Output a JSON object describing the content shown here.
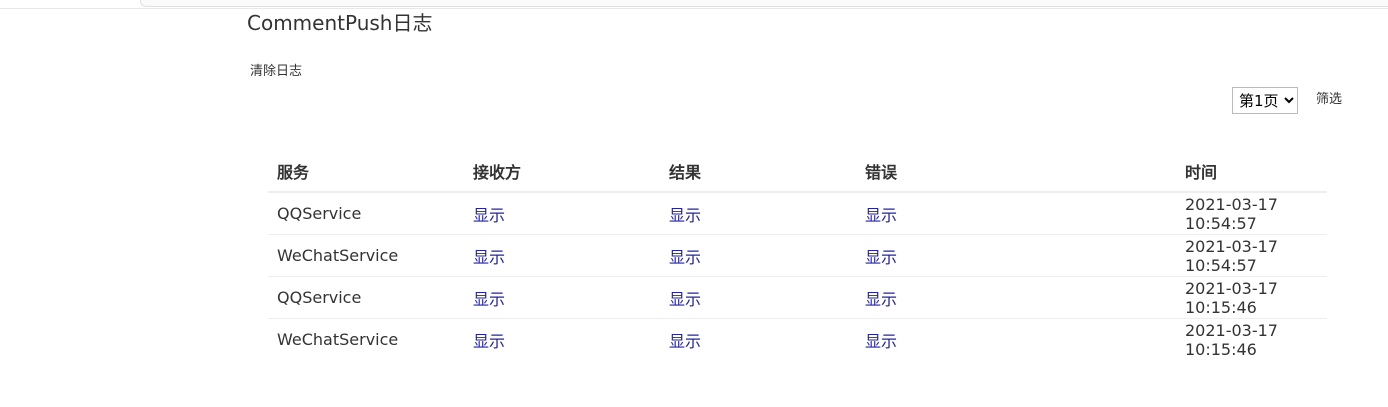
{
  "page": {
    "title": "CommentPush日志",
    "clear_label": "清除日志",
    "filter_label": "筛选",
    "page_select": {
      "selected": "第1页",
      "options": [
        "第1页"
      ]
    }
  },
  "table": {
    "headers": {
      "service": "服务",
      "receiver": "接收方",
      "result": "结果",
      "error": "错误",
      "time": "时间"
    },
    "rows": [
      {
        "service": "QQService",
        "receiver": "显示",
        "result": "显示",
        "error": "显示",
        "time": "2021-03-17 10:54:57"
      },
      {
        "service": "WeChatService",
        "receiver": "显示",
        "result": "显示",
        "error": "显示",
        "time": "2021-03-17 10:54:57"
      },
      {
        "service": "QQService",
        "receiver": "显示",
        "result": "显示",
        "error": "显示",
        "time": "2021-03-17 10:15:46"
      },
      {
        "service": "WeChatService",
        "receiver": "显示",
        "result": "显示",
        "error": "显示",
        "time": "2021-03-17 10:15:46"
      }
    ]
  },
  "colors": {
    "link": "#2222aa",
    "text": "#333333",
    "divider": "#eeeeee"
  }
}
